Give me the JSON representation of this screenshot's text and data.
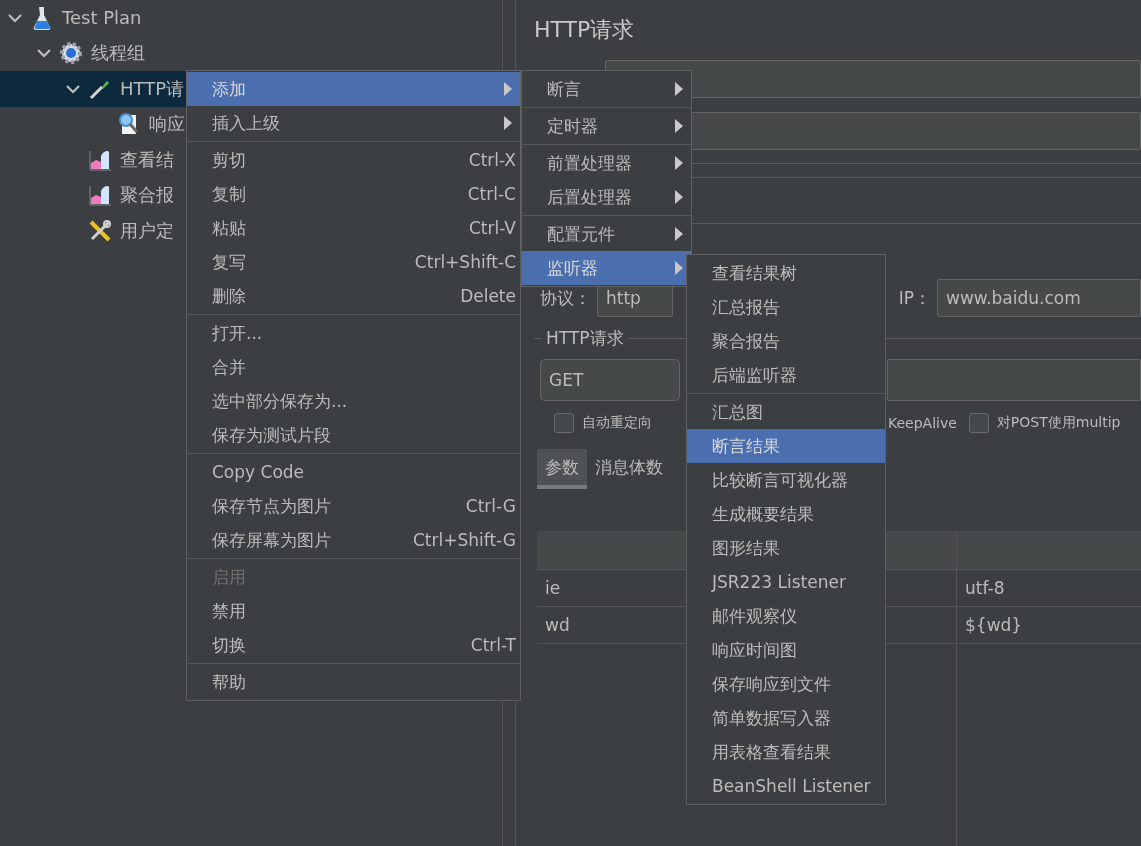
{
  "tree": [
    {
      "label": "Test Plan",
      "kind": "flask",
      "expanded": true,
      "selected": false,
      "children": [
        {
          "label": "线程组",
          "kind": "gear",
          "expanded": true,
          "selected": false,
          "children": [
            {
              "label": "HTTP请",
              "kind": "dropper",
              "expanded": true,
              "selected": true,
              "children": [
                {
                  "label": "响应",
                  "kind": "magnifier",
                  "selected": false
                }
              ]
            },
            {
              "label": "查看结",
              "kind": "chart",
              "selected": false
            },
            {
              "label": "聚合报",
              "kind": "chart",
              "selected": false
            },
            {
              "label": "用户定",
              "kind": "tools",
              "selected": false
            }
          ]
        }
      ]
    }
  ],
  "panel": {
    "title": "HTTP请求",
    "protocol_label": "协议：",
    "protocol_value": "http",
    "server_label": "IP：",
    "server_value": "www.baidu.com",
    "group_title": "HTTP请求",
    "method": "GET",
    "checkboxes": [
      {
        "kind": "checkbox",
        "label": "自动重定向",
        "checked": false
      },
      {
        "kind": "text",
        "label": "KeepAlive"
      },
      {
        "kind": "checkbox",
        "label": "对POST使用multip",
        "checked": false
      }
    ],
    "tabs": [
      {
        "label": "参数",
        "selected": true
      },
      {
        "label": "消息体数",
        "selected": false
      }
    ],
    "table": {
      "rows": [
        {
          "name": "ie",
          "value": "utf-8"
        },
        {
          "name": "wd",
          "value": "${wd}"
        }
      ]
    }
  },
  "context_menu": [
    {
      "kind": "item",
      "label": "添加",
      "submenu": true,
      "selected": true,
      "disabled": false
    },
    {
      "kind": "item",
      "label": "插入上级",
      "submenu": true,
      "selected": false,
      "disabled": false
    },
    {
      "kind": "separator"
    },
    {
      "kind": "item",
      "label": "剪切",
      "shortcut": "Ctrl-X",
      "selected": false,
      "disabled": false
    },
    {
      "kind": "item",
      "label": "复制",
      "shortcut": "Ctrl-C",
      "selected": false,
      "disabled": false
    },
    {
      "kind": "item",
      "label": "粘贴",
      "shortcut": "Ctrl-V",
      "selected": false,
      "disabled": false
    },
    {
      "kind": "item",
      "label": "复写",
      "shortcut": "Ctrl+Shift-C",
      "selected": false,
      "disabled": false
    },
    {
      "kind": "item",
      "label": "删除",
      "shortcut": "Delete",
      "selected": false,
      "disabled": false
    },
    {
      "kind": "separator"
    },
    {
      "kind": "item",
      "label": "打开...",
      "selected": false,
      "disabled": false
    },
    {
      "kind": "item",
      "label": "合并",
      "selected": false,
      "disabled": false
    },
    {
      "kind": "item",
      "label": "选中部分保存为...",
      "selected": false,
      "disabled": false
    },
    {
      "kind": "item",
      "label": "保存为测试片段",
      "selected": false,
      "disabled": false
    },
    {
      "kind": "separator"
    },
    {
      "kind": "item",
      "label": "Copy Code",
      "selected": false,
      "disabled": false
    },
    {
      "kind": "item",
      "label": "保存节点为图片",
      "shortcut": "Ctrl-G",
      "selected": false,
      "disabled": false
    },
    {
      "kind": "item",
      "label": "保存屏幕为图片",
      "shortcut": "Ctrl+Shift-G",
      "selected": false,
      "disabled": false
    },
    {
      "kind": "separator"
    },
    {
      "kind": "item",
      "label": "启用",
      "selected": false,
      "disabled": true
    },
    {
      "kind": "item",
      "label": "禁用",
      "selected": false,
      "disabled": false
    },
    {
      "kind": "item",
      "label": "切换",
      "shortcut": "Ctrl-T",
      "selected": false,
      "disabled": false
    },
    {
      "kind": "separator"
    },
    {
      "kind": "item",
      "label": "帮助",
      "selected": false,
      "disabled": false
    }
  ],
  "add_submenu": [
    {
      "kind": "item",
      "label": "断言",
      "submenu": true,
      "selected": false
    },
    {
      "kind": "separator"
    },
    {
      "kind": "item",
      "label": "定时器",
      "submenu": true,
      "selected": false
    },
    {
      "kind": "separator"
    },
    {
      "kind": "item",
      "label": "前置处理器",
      "submenu": true,
      "selected": false
    },
    {
      "kind": "item",
      "label": "后置处理器",
      "submenu": true,
      "selected": false
    },
    {
      "kind": "separator"
    },
    {
      "kind": "item",
      "label": "配置元件",
      "submenu": true,
      "selected": false
    },
    {
      "kind": "item",
      "label": "监听器",
      "submenu": true,
      "selected": true
    }
  ],
  "listener_submenu": [
    {
      "kind": "item",
      "label": "查看结果树",
      "selected": false
    },
    {
      "kind": "item",
      "label": "汇总报告",
      "selected": false
    },
    {
      "kind": "item",
      "label": "聚合报告",
      "selected": false
    },
    {
      "kind": "item",
      "label": "后端监听器",
      "selected": false
    },
    {
      "kind": "separator"
    },
    {
      "kind": "item",
      "label": "汇总图",
      "selected": false
    },
    {
      "kind": "item",
      "label": "断言结果",
      "selected": true
    },
    {
      "kind": "item",
      "label": "比较断言可视化器",
      "selected": false
    },
    {
      "kind": "item",
      "label": "生成概要结果",
      "selected": false
    },
    {
      "kind": "item",
      "label": "图形结果",
      "selected": false
    },
    {
      "kind": "item",
      "label": "JSR223 Listener",
      "selected": false
    },
    {
      "kind": "item",
      "label": "邮件观察仪",
      "selected": false
    },
    {
      "kind": "item",
      "label": "响应时间图",
      "selected": false
    },
    {
      "kind": "item",
      "label": "保存响应到文件",
      "selected": false
    },
    {
      "kind": "item",
      "label": "简单数据写入器",
      "selected": false
    },
    {
      "kind": "item",
      "label": "用表格查看结果",
      "selected": false
    },
    {
      "kind": "item",
      "label": "BeanShell Listener",
      "selected": false
    }
  ]
}
